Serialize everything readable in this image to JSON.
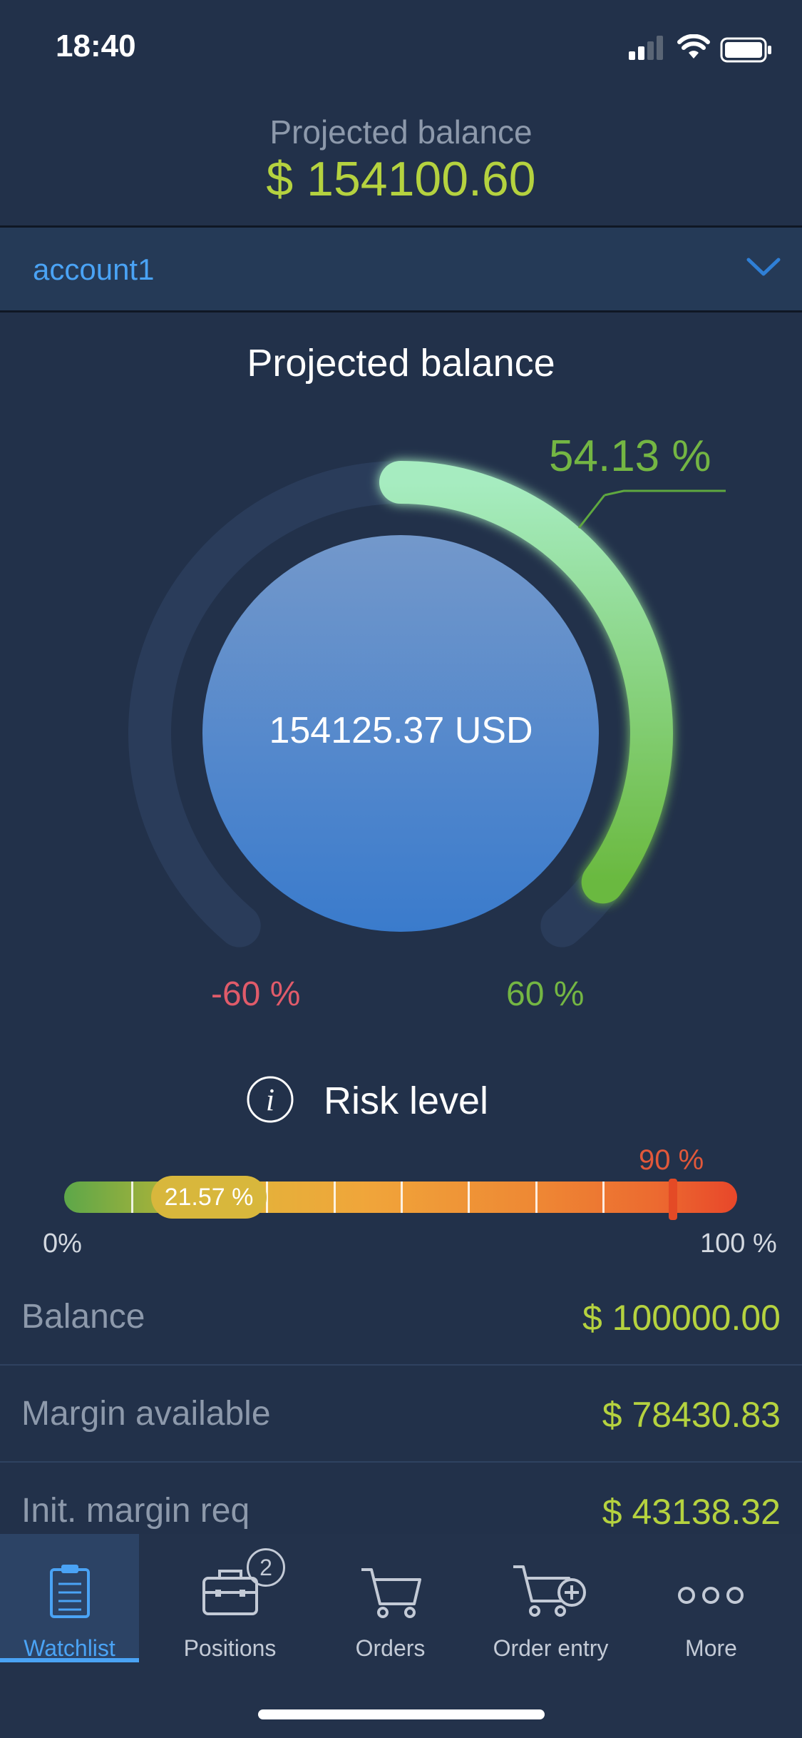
{
  "status_bar": {
    "time": "18:40"
  },
  "header": {
    "title": "Projected balance",
    "value": "$ 154100.60"
  },
  "account": {
    "name": "account1"
  },
  "section": {
    "title": "Projected balance"
  },
  "gauge": {
    "center_value": "154125.37 USD",
    "percent_label": "54.13 %",
    "percent": 54.13,
    "min_label": "-60 %",
    "max_label": "60 %",
    "min": -60,
    "max": 60,
    "colors": {
      "track": "#2a3c5a",
      "arc_start": "#a6ecc0",
      "arc_end": "#6ab93f",
      "center_top": "#7398cb",
      "center_bottom": "#3a7bcc"
    }
  },
  "risk": {
    "title": "Risk level",
    "value_label": "21.57 %",
    "value": 21.57,
    "threshold_label": "90 %",
    "threshold": 90,
    "min_label": "0%",
    "max_label": "100 %"
  },
  "rows": [
    {
      "label": "Balance",
      "value": "$ 100000.00"
    },
    {
      "label": "Margin available",
      "value": "$ 78430.83"
    },
    {
      "label": "Init. margin req",
      "value": "$ 43138.32"
    }
  ],
  "tabs": [
    {
      "label": "Watchlist",
      "icon": "clipboard-icon",
      "active": true
    },
    {
      "label": "Positions",
      "icon": "briefcase-icon",
      "badge": "2"
    },
    {
      "label": "Orders",
      "icon": "cart-icon"
    },
    {
      "label": "Order entry",
      "icon": "cart-plus-icon"
    },
    {
      "label": "More",
      "icon": "more-dots-icon"
    }
  ]
}
